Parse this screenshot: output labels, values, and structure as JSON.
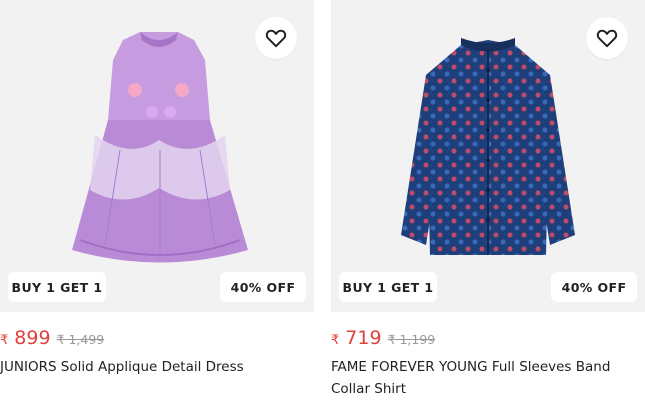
{
  "products": [
    {
      "offer_tag": "BUY 1 GET 1",
      "discount_tag": "40% OFF",
      "currency": "₹",
      "price": "899",
      "mrp": "₹ 1,499",
      "title": "JUNIORS Solid Applique Detail Dress",
      "wishlist_icon": "heart-outline-icon"
    },
    {
      "offer_tag": "BUY 1 GET 1",
      "discount_tag": "40% OFF",
      "currency": "₹",
      "price": "719",
      "mrp": "₹ 1,199",
      "title": "FAME FOREVER YOUNG Full Sleeves Band Collar Shirt",
      "wishlist_icon": "heart-outline-icon"
    }
  ],
  "colors": {
    "price": "#e0413a",
    "image_bg": "#f2f2f2",
    "dress": "#b98bd6",
    "shirt": "#1f3f7a"
  }
}
